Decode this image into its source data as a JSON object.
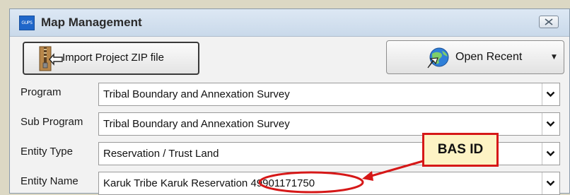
{
  "window": {
    "title": "Map Management",
    "app_icon_text": "GUPS",
    "close_icon": "close-x-icon"
  },
  "toolbar": {
    "import_label": "Import Project ZIP file",
    "import_icon": "zip-file-arrow-icon",
    "open_recent_label": "Open Recent",
    "open_recent_icon": "globe-arrow-icon"
  },
  "fields": [
    {
      "label": "Program",
      "value": "Tribal Boundary and Annexation Survey"
    },
    {
      "label": "Sub Program",
      "value": "Tribal Boundary and Annexation Survey"
    },
    {
      "label": "Entity Type",
      "value": "Reservation / Trust Land"
    },
    {
      "label": "Entity Name",
      "value_name": "Karuk Tribe Karuk Reservation",
      "value_id": "49901171750"
    }
  ],
  "annotation": {
    "callout_label": "BAS ID",
    "color": "#d61818",
    "callout_fill": "#fdf3c4"
  }
}
